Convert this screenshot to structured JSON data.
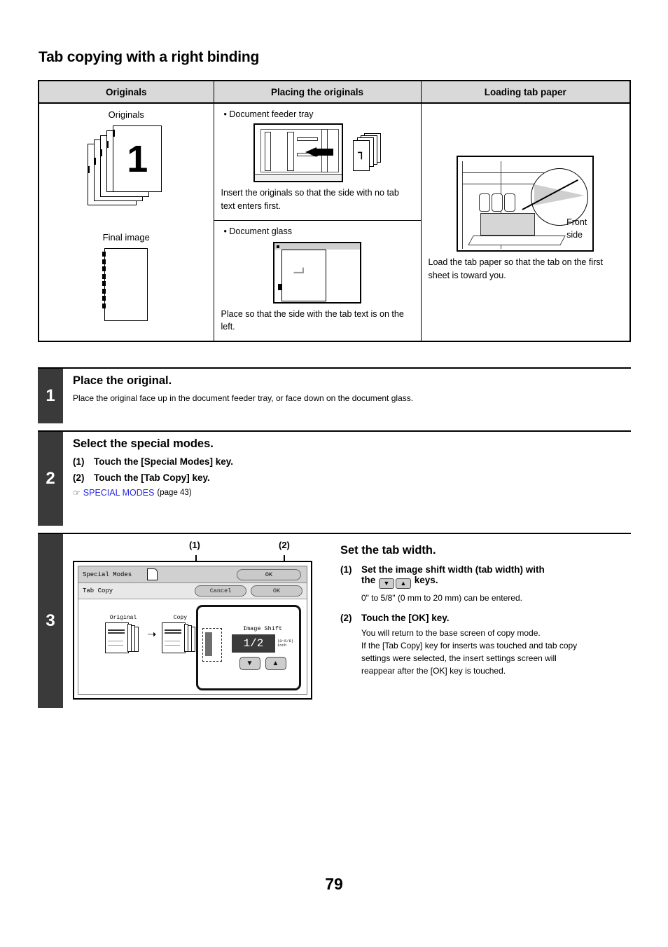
{
  "page": {
    "title": "Tab copying with a right binding",
    "number": "79"
  },
  "table": {
    "headers": [
      "Originals",
      "Placing the originals",
      "Loading tab paper"
    ],
    "originals_col": {
      "originals_label": "Originals",
      "originals_page_number": "1",
      "final_image_label": "Final image"
    },
    "placing_col": {
      "feeder_bullet": "• Document feeder tray",
      "feeder_caption": "Insert the originals so that the side with no tab text enters first.",
      "glass_bullet": "• Document glass",
      "glass_caption": "Place so that the side with the tab text is on the left."
    },
    "loading_col": {
      "front_side_label_line1": "Front",
      "front_side_label_line2": "side",
      "caption": "Load the tab paper so that the tab on the first sheet is toward you."
    }
  },
  "steps": [
    {
      "number": "1",
      "heading": "Place the original.",
      "description": "Place the original face up in the document feeder tray, or face down on the document glass."
    },
    {
      "number": "2",
      "heading": "Select the special modes.",
      "sub1_index": "(1)",
      "sub1_text": "Touch the [Special Modes] key.",
      "sub2_index": "(2)",
      "sub2_text": "Touch the [Tab Copy] key.",
      "link_text": "SPECIAL MODES",
      "link_page": "(page 43)"
    },
    {
      "number": "3",
      "heading": "Set the tab width.",
      "callout_1": "(1)",
      "callout_2": "(2)",
      "sub1_index": "(1)",
      "sub1_text_a": "Set the image shift width (tab width) with",
      "sub1_text_b": "the",
      "sub1_text_c": "keys.",
      "sub1_note": "0\" to 5/8\" (0 mm to 20 mm) can be entered.",
      "sub2_index": "(2)",
      "sub2_text": "Touch the [OK] key.",
      "sub2_note_line1": "You will return to the base screen of copy mode.",
      "sub2_note_line2": "If the [Tab Copy] key for inserts was touched and tab copy",
      "sub2_note_line3": "settings were selected, the insert settings screen will",
      "sub2_note_line4": "reappear after the [OK] key is touched."
    }
  ],
  "lcd": {
    "title_bar": "Special Modes",
    "ok_top": "OK",
    "tab_copy_title": "Tab Copy",
    "cancel_key": "Cancel",
    "ok_key": "OK",
    "original_label": "Original",
    "copy_label": "Copy",
    "image_shift_title": "Image Shift",
    "image_shift_value": "1/2",
    "image_shift_range_line1": "(0~5/8)",
    "image_shift_range_line2": "inch",
    "down_key": "▼",
    "up_key": "▲"
  },
  "colors": {
    "header_bg": "#d9d9d9",
    "step_badge": "#3a3a3a",
    "link": "#2b2bdd"
  }
}
